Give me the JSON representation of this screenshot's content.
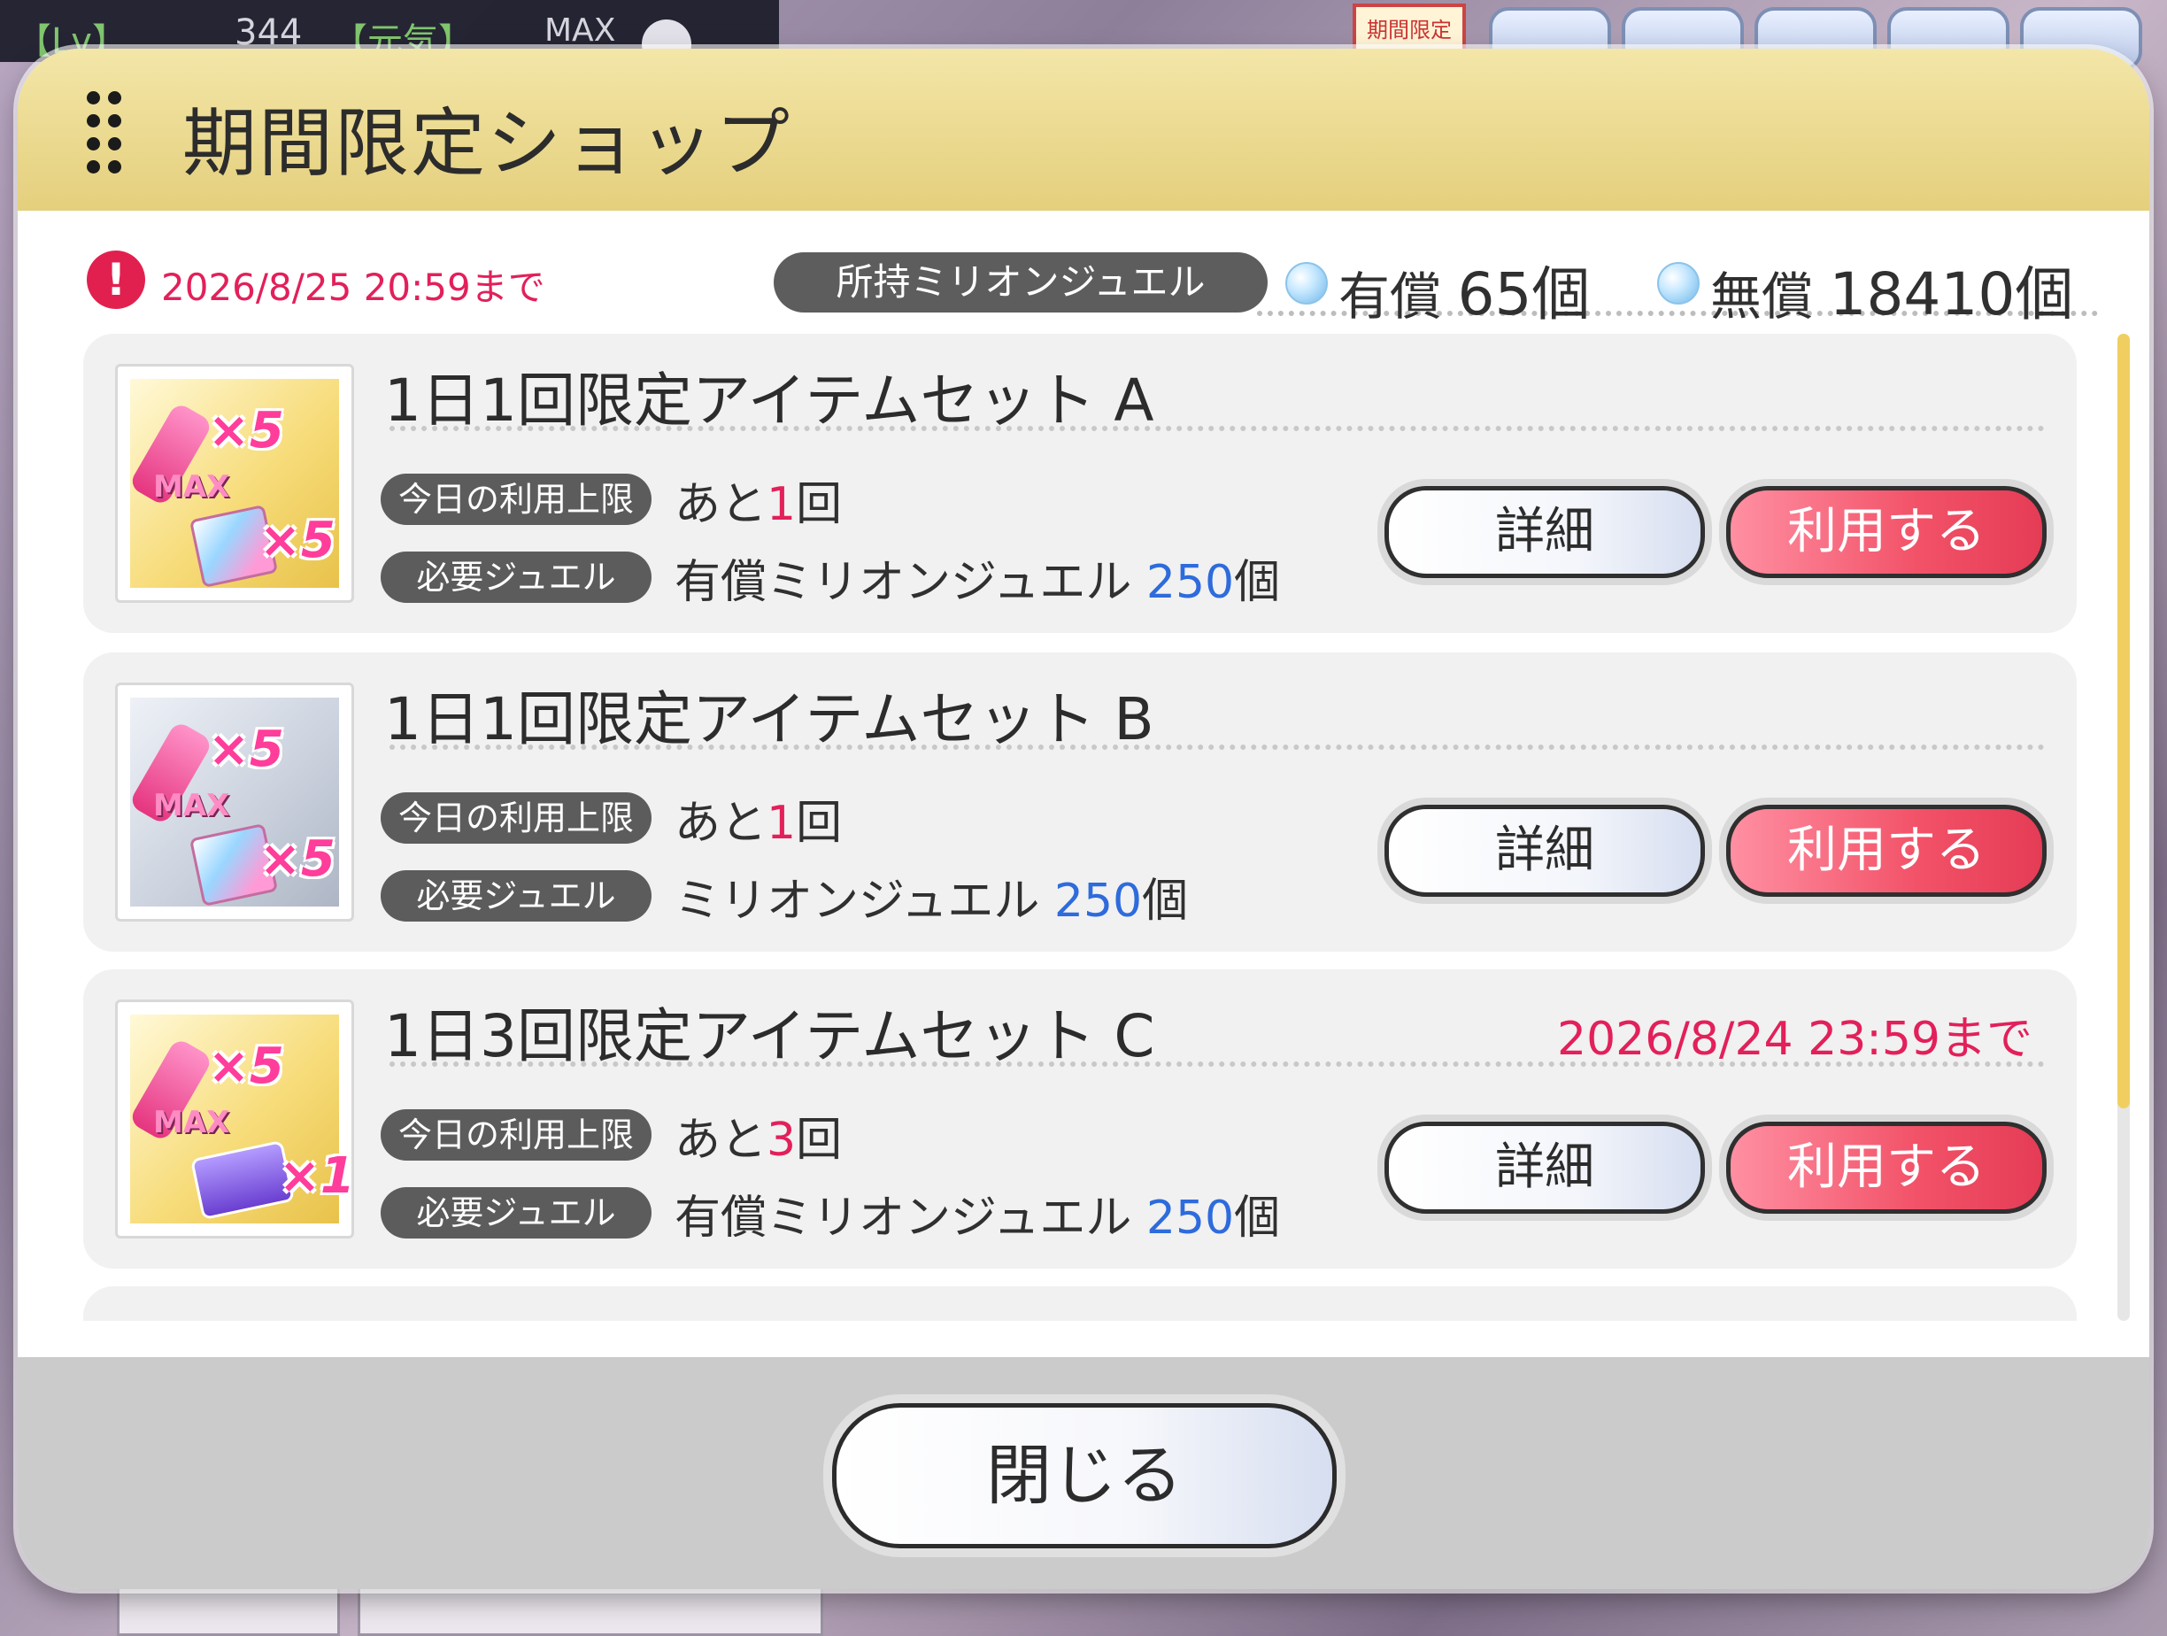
{
  "hud": {
    "lv_label": "【Lv】",
    "level": "344",
    "state": "【元気】",
    "max": "MAX",
    "limited_badge": "期間限定"
  },
  "dialog": {
    "title": "期間限定ショップ",
    "deadline": "2026/8/25 20:59まで",
    "alert_icon": "!",
    "jewel_label": "所持ミリオンジュエル",
    "paid_prefix": "有償",
    "paid_count": "65個",
    "free_prefix": "無償",
    "free_count": "18410個"
  },
  "items": [
    {
      "title": "1日1回限定アイテムセット A",
      "deadline": "",
      "limit_label": "今日の利用上限",
      "limit_prefix": "あと",
      "limit_value": "1",
      "limit_suffix": "回",
      "cost_label": "必要ジュエル",
      "cost_text": "有償ミリオンジュエル ",
      "cost_value": "250",
      "cost_suffix": "個",
      "thumb_qty_1": "×5",
      "thumb_qty_2": "×5",
      "thumb_tag": "MAX",
      "detail_label": "詳細",
      "use_label": "利用する"
    },
    {
      "title": "1日1回限定アイテムセット B",
      "deadline": "",
      "limit_label": "今日の利用上限",
      "limit_prefix": "あと",
      "limit_value": "1",
      "limit_suffix": "回",
      "cost_label": "必要ジュエル",
      "cost_text": "ミリオンジュエル ",
      "cost_value": "250",
      "cost_suffix": "個",
      "thumb_qty_1": "×5",
      "thumb_qty_2": "×5",
      "thumb_tag": "MAX",
      "detail_label": "詳細",
      "use_label": "利用する"
    },
    {
      "title": "1日3回限定アイテムセット C",
      "deadline": "2026/8/24 23:59まで",
      "limit_label": "今日の利用上限",
      "limit_prefix": "あと",
      "limit_value": "3",
      "limit_suffix": "回",
      "cost_label": "必要ジュエル",
      "cost_text": "有償ミリオンジュエル ",
      "cost_value": "250",
      "cost_suffix": "個",
      "thumb_qty_1": "×5",
      "thumb_qty_2": "×1",
      "thumb_tag": "MAX",
      "detail_label": "詳細",
      "use_label": "利用する"
    }
  ],
  "footer": {
    "close_label": "閉じる"
  },
  "colors": {
    "header_gold": "#e4cf7c",
    "accent_red": "#e2205a",
    "accent_blue": "#2e6bdc",
    "use_button": "#f25268",
    "scroll_thumb": "#f0cf60"
  }
}
